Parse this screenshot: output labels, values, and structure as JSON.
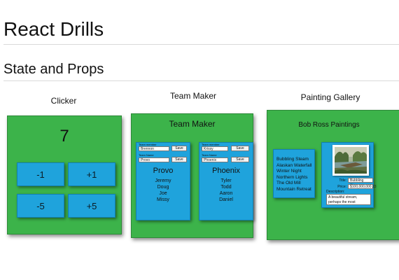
{
  "page": {
    "title": "React Drills",
    "subtitle": "State and Props"
  },
  "clicker": {
    "title": "Clicker",
    "count": "7",
    "buttons": [
      "-1",
      "+1",
      "-5",
      "+5"
    ]
  },
  "team_maker": {
    "title": "Team Maker",
    "panel_title": "Team Maker",
    "teams": [
      {
        "member_label": "Team member",
        "member_value": "Brennon",
        "name_label": "Team Name",
        "name_value": "Provo",
        "save_label": "Save",
        "team_name": "Provo",
        "members": [
          "Jeremy",
          "Doug",
          "Joe",
          "Missy"
        ]
      },
      {
        "member_label": "Team member",
        "member_value": "Krissy",
        "name_label": "Team Name",
        "name_value": "Phoenix",
        "save_label": "Save",
        "team_name": "Phoenix",
        "members": [
          "Tyler",
          "Todd",
          "Aaron",
          "Daniel"
        ]
      }
    ]
  },
  "gallery": {
    "title": "Painting Gallery",
    "panel_title": "Bob Ross Paintings",
    "paintings": [
      "Bubbling Steam",
      "Alaskan Waterfall",
      "Winter Night",
      "Northern Lights",
      "The Old Mill",
      "Mountain Retreat"
    ],
    "detail": {
      "title_label": "Title:",
      "title_value": "Bubbling Stream",
      "price_label": "Price:",
      "price_value": "$100,000,000.23",
      "description_label": "Description:",
      "description_value": "A beautiful stream, perhaps the most beautiful of all time"
    }
  },
  "colors": {
    "panel_green": "#3cb34a",
    "card_blue": "#1fa3dc"
  }
}
